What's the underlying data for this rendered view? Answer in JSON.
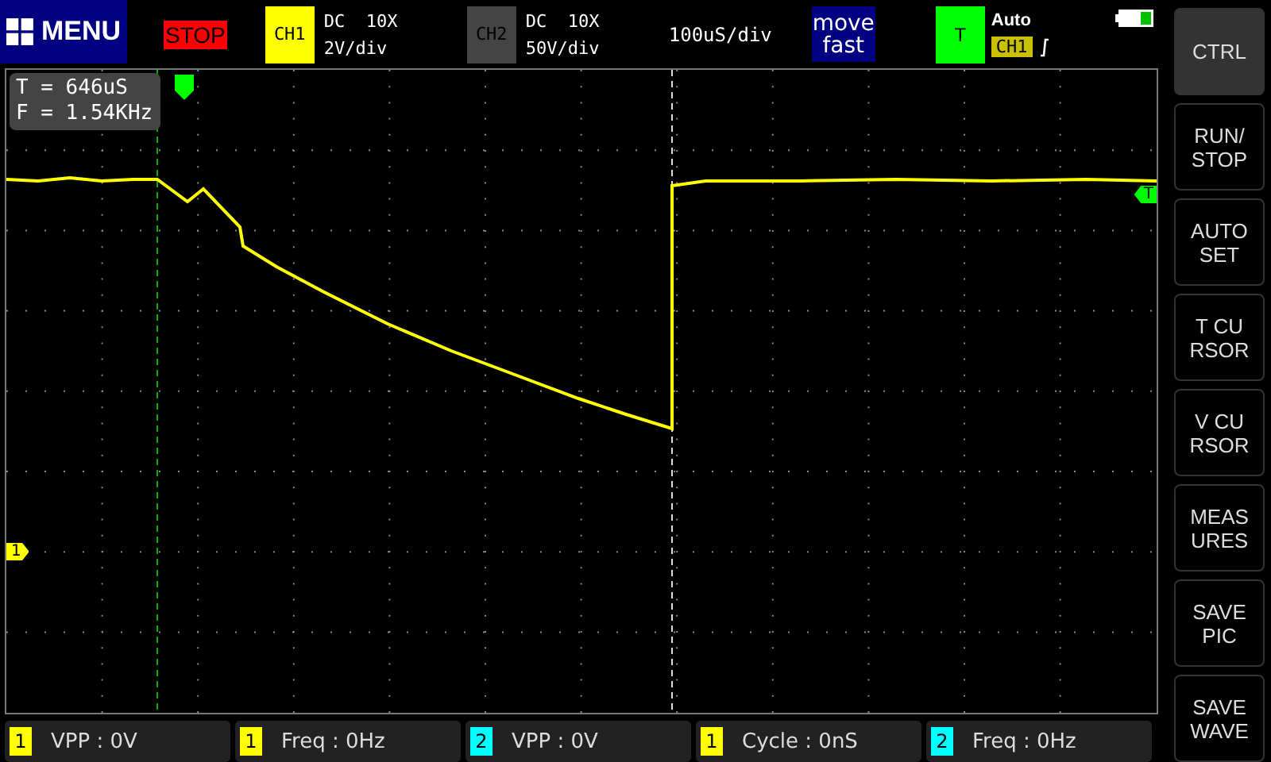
{
  "menu": {
    "label": "MENU"
  },
  "run_state": {
    "label": "STOP"
  },
  "channels": [
    {
      "label": "CH1",
      "coupling": "DC  10X",
      "scale": "2V/div",
      "color": "#ffff00"
    },
    {
      "label": "CH2",
      "coupling": "DC  10X",
      "scale": "50V/div",
      "color": "#444444"
    }
  ],
  "timebase": "100uS/div",
  "move_mode": [
    "move",
    "fast"
  ],
  "trigger": {
    "label": "T",
    "mode": "Auto",
    "source": "CH1"
  },
  "cursor_readout": [
    "T = 646uS",
    "F = 1.54KHz"
  ],
  "markers": {
    "channel": "1",
    "trigger": "T"
  },
  "side_buttons": [
    {
      "lines": [
        "CTRL"
      ],
      "selected": true
    },
    {
      "lines": [
        "RUN/",
        "STOP"
      ],
      "selected": false
    },
    {
      "lines": [
        "AUTO",
        "SET"
      ],
      "selected": false
    },
    {
      "lines": [
        "T CU",
        "RSOR"
      ],
      "selected": false
    },
    {
      "lines": [
        "V CU",
        "RSOR"
      ],
      "selected": false
    },
    {
      "lines": [
        "MEAS",
        "URES"
      ],
      "selected": false
    },
    {
      "lines": [
        "SAVE",
        "PIC"
      ],
      "selected": false
    },
    {
      "lines": [
        "SAVE",
        "WAVE"
      ],
      "selected": false
    }
  ],
  "measurements": [
    {
      "channel": "1",
      "color": "#ffff00",
      "text": "VPP : 0V"
    },
    {
      "channel": "1",
      "color": "#ffff00",
      "text": "Freq : 0Hz"
    },
    {
      "channel": "2",
      "color": "#00ffff",
      "text": "VPP : 0V"
    },
    {
      "channel": "1",
      "color": "#ffff00",
      "text": "Cycle : 0nS"
    },
    {
      "channel": "2",
      "color": "#00ffff",
      "text": "Freq : 0Hz"
    }
  ]
}
